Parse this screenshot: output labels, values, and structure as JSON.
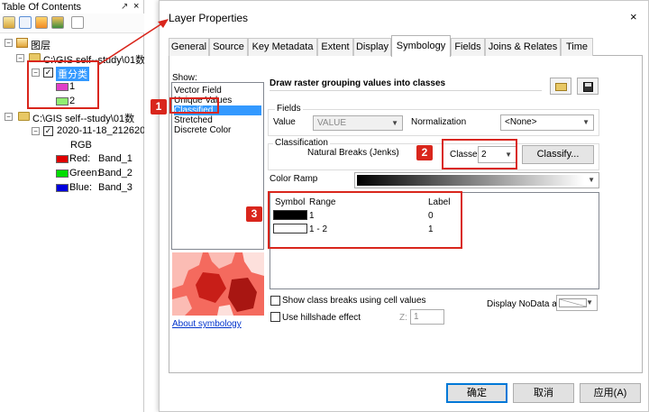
{
  "toc": {
    "title": "Table Of Contents",
    "pin": "↗",
    "close": "×",
    "tree": {
      "group_label": "图层",
      "layer1_path": "C:\\GIS  self--study\\01数",
      "layer1_name": "重分类",
      "layer1_classes": [
        {
          "label": "1",
          "color": "#e040c8"
        },
        {
          "label": "2",
          "color": "#90ee70"
        }
      ],
      "layer2_path": "C:\\GIS  self--study\\01数",
      "layer2_name": "2020-11-18_212620",
      "layer2_mode": "RGB",
      "bands": [
        {
          "channel": "Red:",
          "band": "Band_1",
          "color": "#e00000"
        },
        {
          "channel": "Green:",
          "band": "Band_2",
          "color": "#00dd00"
        },
        {
          "channel": "Blue:",
          "band": "Band_3",
          "color": "#0000dd"
        }
      ]
    }
  },
  "callouts": [
    "1",
    "2",
    "3"
  ],
  "dialog": {
    "title": "Layer Properties",
    "close": "×",
    "tabs": [
      "General",
      "Source",
      "Key Metadata",
      "Extent",
      "Display",
      "Symbology",
      "Fields",
      "Joins & Relates",
      "Time"
    ],
    "active_tab": "Symbology",
    "show_label": "Show:",
    "show_items": [
      "Vector Field",
      "Unique Values",
      "Classified",
      "Stretched",
      "Discrete Color"
    ],
    "selected_show": "Classified",
    "heading": "Draw raster grouping values into classes",
    "fields_group": "Fields",
    "value_label": "Value",
    "value_field": "VALUE",
    "normalization_label": "Normalization",
    "normalization_value": "<None>",
    "classification_group": "Classification",
    "method": "Natural Breaks (Jenks)",
    "classes_label": "Classes",
    "classes_value": "2",
    "classify_button": "Classify...",
    "color_ramp_label": "Color Ramp",
    "table_headers": {
      "symbol": "Symbol",
      "range": "Range",
      "label": "Label"
    },
    "table_rows": [
      {
        "range": "1",
        "label": "0",
        "symbol_color": "#000000"
      },
      {
        "range": "1 - 2",
        "label": "1",
        "symbol_color": "#ffffff"
      }
    ],
    "about_link": "About symbology",
    "show_breaks_label": "Show class breaks using cell values",
    "hillshade_label": "Use hillshade effect",
    "z_label": "Z:",
    "z_value": "1",
    "nodata_label": "Display NoData as",
    "ok_button": "确定",
    "cancel_button": "取消",
    "apply_button": "应用(A)"
  },
  "colors": {
    "accent_red": "#d9261c",
    "selection_blue": "#3399ff",
    "link_blue": "#0033cc"
  }
}
